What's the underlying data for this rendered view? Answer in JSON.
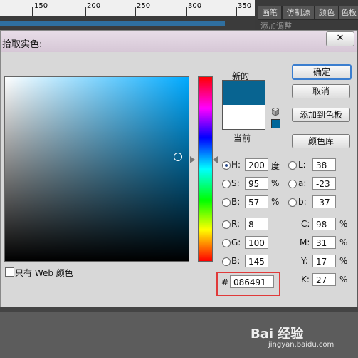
{
  "ruler": {
    "labels": [
      "150",
      "200",
      "250",
      "300",
      "350"
    ]
  },
  "panel_tabs": [
    "画笔",
    "仿制源",
    "颜色",
    "色板"
  ],
  "add_adjust_text": "添加调整",
  "dialog": {
    "title": "拾取实色:",
    "close_symbol": "✕",
    "new_label": "新的",
    "current_label": "当前",
    "new_color": "#086491",
    "current_color": "#ffffff",
    "websafe_color": "#006699",
    "buttons": {
      "ok": "确定",
      "cancel": "取消",
      "add_swatch": "添加到色板",
      "library": "颜色库"
    },
    "web_only_label": "只有 Web 颜色",
    "fields": {
      "H": {
        "label": "H:",
        "value": "200",
        "unit": "度"
      },
      "S": {
        "label": "S:",
        "value": "95",
        "unit": "%"
      },
      "B": {
        "label": "B:",
        "value": "57",
        "unit": "%"
      },
      "R": {
        "label": "R:",
        "value": "8"
      },
      "G": {
        "label": "G:",
        "value": "100"
      },
      "B2": {
        "label": "B:",
        "value": "145"
      },
      "L": {
        "label": "L:",
        "value": "38"
      },
      "a": {
        "label": "a:",
        "value": "-23"
      },
      "b": {
        "label": "b:",
        "value": "-37"
      },
      "C": {
        "label": "C:",
        "value": "98",
        "unit": "%"
      },
      "M": {
        "label": "M:",
        "value": "31",
        "unit": "%"
      },
      "Y": {
        "label": "Y:",
        "value": "17",
        "unit": "%"
      },
      "K": {
        "label": "K:",
        "value": "27",
        "unit": "%"
      }
    },
    "hex_symbol": "#",
    "hex_value": "086491"
  },
  "watermark": {
    "main": "Bai 经验",
    "sub": "jingyan.baidu.com"
  }
}
